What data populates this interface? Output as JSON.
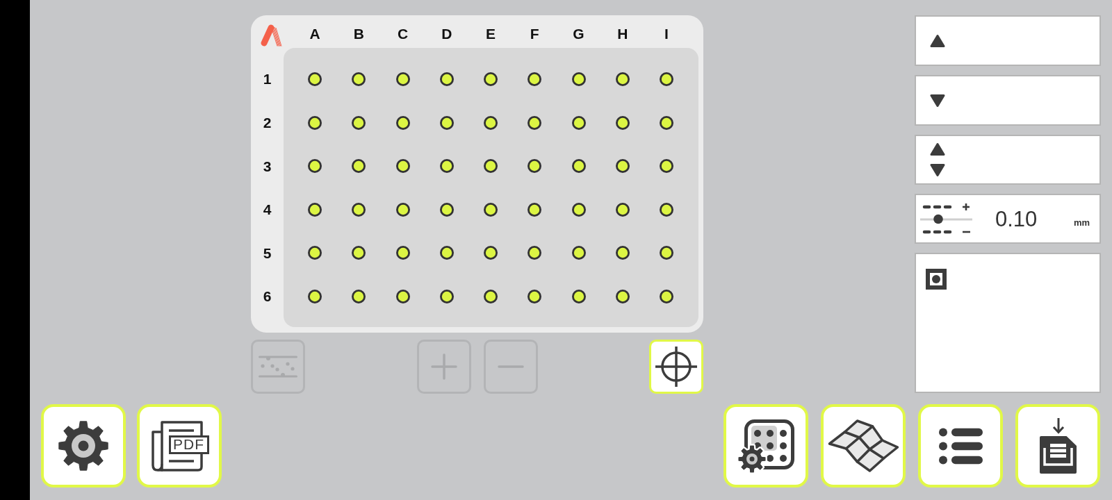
{
  "plate": {
    "columns": [
      "A",
      "B",
      "C",
      "D",
      "E",
      "F",
      "G",
      "H",
      "I"
    ],
    "rows": [
      "1",
      "2",
      "3",
      "4",
      "5",
      "6"
    ]
  },
  "plate_tools": [
    {
      "kind": "scatter",
      "disabled": true
    },
    {
      "kind": "zoom-in",
      "disabled": true
    },
    {
      "kind": "zoom-out",
      "disabled": true
    },
    {
      "kind": "crosshair",
      "disabled": false
    }
  ],
  "options": [
    {
      "kind": "up"
    },
    {
      "kind": "down"
    },
    {
      "kind": "up-down"
    },
    {
      "kind": "step",
      "value": "0.10",
      "unit": "mm"
    },
    {
      "kind": "target"
    }
  ],
  "toolbar_left": [
    {
      "kind": "settings"
    },
    {
      "kind": "pdf",
      "label": "PDF"
    }
  ],
  "toolbar_right": [
    {
      "kind": "plate-settings"
    },
    {
      "kind": "surface"
    },
    {
      "kind": "list"
    },
    {
      "kind": "save"
    }
  ]
}
